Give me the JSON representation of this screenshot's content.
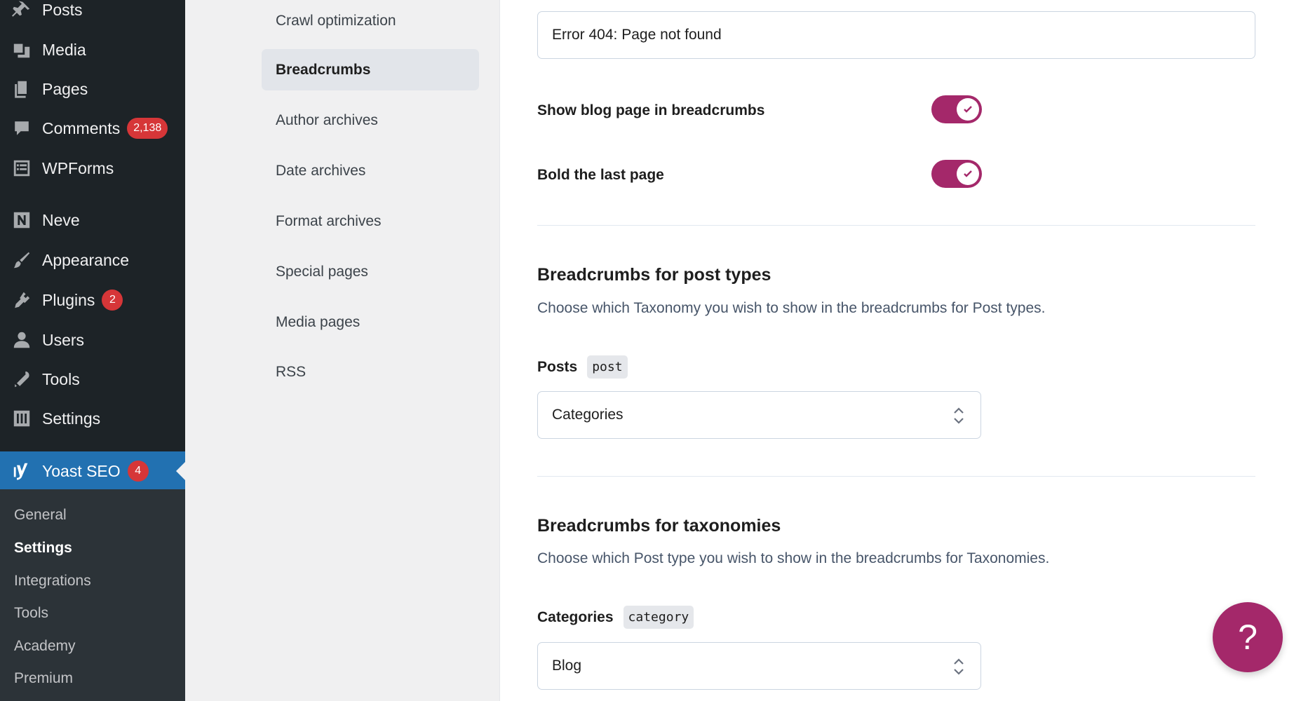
{
  "admin_menu": {
    "items": [
      {
        "label": "Posts",
        "icon": "pushpin-icon"
      },
      {
        "label": "Media",
        "icon": "media-icon"
      },
      {
        "label": "Pages",
        "icon": "pages-icon"
      },
      {
        "label": "Comments",
        "icon": "comment-icon",
        "badge": "2,138"
      },
      {
        "label": "WPForms",
        "icon": "form-icon"
      },
      {
        "label": "Neve",
        "icon": "neve-logo-icon"
      },
      {
        "label": "Appearance",
        "icon": "paintbrush-icon"
      },
      {
        "label": "Plugins",
        "icon": "plugin-icon",
        "badge": "2"
      },
      {
        "label": "Users",
        "icon": "user-icon"
      },
      {
        "label": "Tools",
        "icon": "wrench-icon"
      },
      {
        "label": "Settings",
        "icon": "settings-sliders-icon"
      },
      {
        "label": "Yoast SEO",
        "icon": "yoast-logo-icon",
        "badge": "4"
      }
    ],
    "submenu": [
      "General",
      "Settings",
      "Integrations",
      "Tools",
      "Academy",
      "Premium"
    ]
  },
  "settings_nav": {
    "items": [
      "Crawl optimization",
      "Breadcrumbs",
      "Author archives",
      "Date archives",
      "Format archives",
      "Special pages",
      "Media pages",
      "RSS"
    ],
    "active": "Breadcrumbs"
  },
  "content": {
    "error_input_value": "Error 404: Page not found",
    "toggle_blog_label": "Show blog page in breadcrumbs",
    "toggle_bold_label": "Bold the last page",
    "post_types": {
      "title": "Breadcrumbs for post types",
      "description": "Choose which Taxonomy you wish to show in the breadcrumbs for Post types.",
      "field_label": "Posts",
      "field_code": "post",
      "selected": "Categories"
    },
    "taxonomies": {
      "title": "Breadcrumbs for taxonomies",
      "description": "Choose which Post type you wish to show in the breadcrumbs for Taxonomies.",
      "field_label": "Categories",
      "field_code": "category",
      "selected": "Blog"
    },
    "help_label": "?"
  },
  "colors": {
    "accent": "#a4286a",
    "admin_bg": "#1d2327",
    "admin_current": "#2271b1",
    "badge": "#d63638"
  }
}
